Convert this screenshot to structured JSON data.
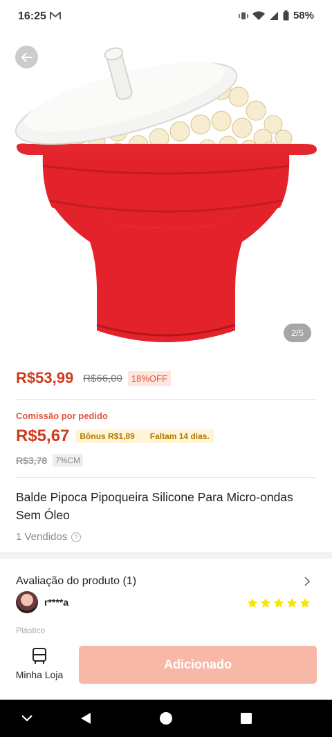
{
  "status_bar": {
    "time": "16:25",
    "battery": "58%"
  },
  "gallery": {
    "counter": "2/5"
  },
  "price": {
    "current": "R$53,99",
    "original": "R$66,00",
    "discount": "18%OFF"
  },
  "commission": {
    "label": "Comissão por pedido",
    "value": "R$5,67",
    "bonus": "Bônus R$1,89",
    "deadline": "Faltam 14 dias.",
    "original": "R$3,78",
    "rate": "7%CM"
  },
  "product": {
    "title": "Balde Pipoca Pipoqueira Silicone Para Micro-ondas Sem Óleo",
    "sold": "1 Vendidos"
  },
  "reviews": {
    "title": "Avaliação do produto (1)",
    "reviewer": "r****a",
    "rating": 5,
    "text": "Plástico"
  },
  "action_bar": {
    "store_label": "Minha Loja",
    "add_label": "Adicionado"
  },
  "colors": {
    "accent": "#d03a1c",
    "button_disabled": "#f8b8a8",
    "star": "#f7e600"
  }
}
